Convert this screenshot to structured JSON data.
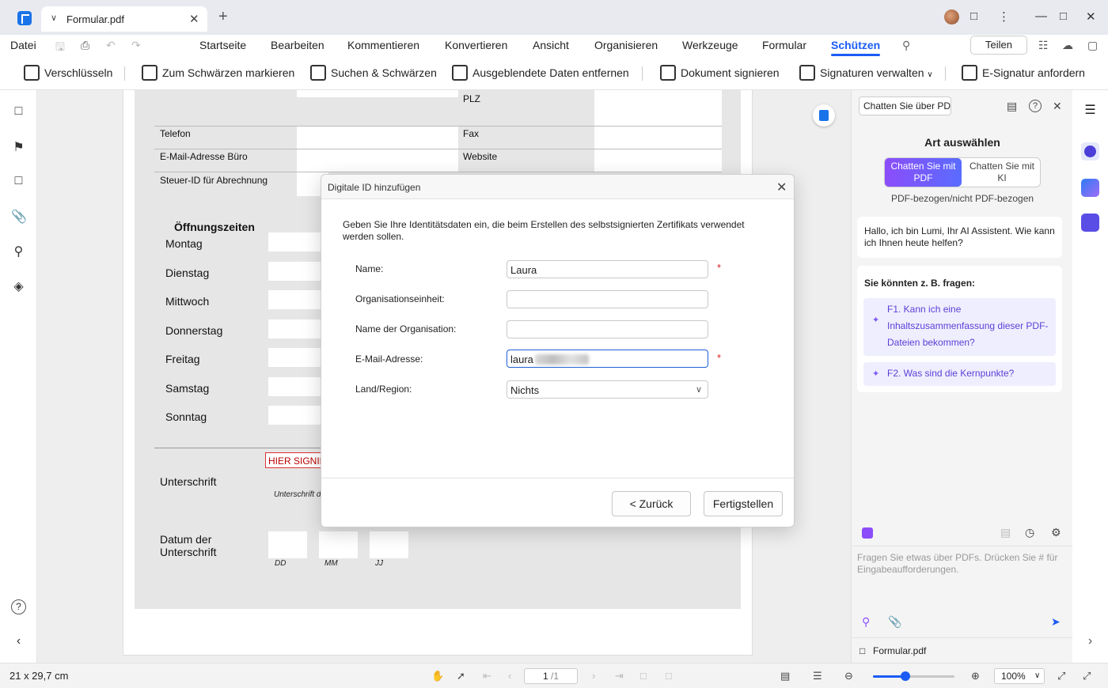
{
  "tab": {
    "title": "Formular.pdf"
  },
  "menu": {
    "file": "Datei",
    "items": [
      "Startseite",
      "Bearbeiten",
      "Kommentieren",
      "Konvertieren",
      "Ansicht",
      "Organisieren",
      "Werkzeuge",
      "Formular",
      "Schützen"
    ],
    "active": "Schützen",
    "share": "Teilen"
  },
  "toolbar": {
    "items": [
      "Verschlüsseln",
      "Zum Schwärzen markieren",
      "Suchen & Schwärzen",
      "Ausgeblendete Daten entfernen",
      "Dokument signieren",
      "Signaturen verwalten",
      "E-Signatur anfordern"
    ]
  },
  "form": {
    "plz": "PLZ",
    "telefon": "Telefon",
    "fax": "Fax",
    "email_buero": "E-Mail-Adresse Büro",
    "website": "Website",
    "steuer": "Steuer-ID für Abrechnung",
    "oeffnungszeiten": "Öffnungszeiten",
    "days": [
      "Montag",
      "Dienstag",
      "Mittwoch",
      "Donnerstag",
      "Freitag",
      "Samstag",
      "Sonntag"
    ],
    "sig_tag": "HIER SIGNIEREN",
    "unterschrift": "Unterschrift",
    "unterschrift_hint": "Unterschrift d",
    "datum_1": "Datum der",
    "datum_2": "Unterschrift",
    "dd": "DD",
    "mm": "MM",
    "jj": "JJ"
  },
  "dialog": {
    "title": "Digitale ID hinzufügen",
    "description": "Geben Sie Ihre Identitätsdaten ein, die beim Erstellen des selbstsignierten Zertifikats verwendet werden sollen.",
    "name_label": "Name:",
    "name_value": "Laura",
    "org_unit_label": "Organisationseinheit:",
    "org_unit_value": "",
    "org_name_label": "Name der Organisation:",
    "org_name_value": "",
    "email_label": "E-Mail-Adresse:",
    "email_value": "laura",
    "country_label": "Land/Region:",
    "country_value": "Nichts",
    "required_mark": "*",
    "back_button": "< Zurück",
    "finish_button": "Fertigstellen"
  },
  "ai_panel": {
    "dropdown": "Chatten Sie über PDF",
    "heading": "Art auswählen",
    "mode_pdf": "Chatten Sie mit PDF",
    "mode_ki": "Chatten Sie mit KI",
    "subtitle": "PDF-bezogen/nicht PDF-bezogen",
    "greeting": "Hallo, ich bin Lumi, Ihr AI Assistent. Wie kann ich Ihnen heute helfen?",
    "suggest_title": "Sie könnten z. B. fragen:",
    "suggestions": [
      "F1. Kann ich eine Inhaltszusammenfassung dieser PDF-Dateien bekommen?",
      "F2. Was sind die Kernpunkte?"
    ],
    "input_placeholder": "Fragen Sie etwas über PDFs. Drücken Sie # für Eingabeaufforderungen.",
    "file_name": "Formular.pdf"
  },
  "status": {
    "page_size": "21 x 29,7 cm",
    "page_current": "1",
    "page_total": "/1",
    "zoom": "100%",
    "zoom_slider_fraction": 0.4
  },
  "colors": {
    "accent": "#1a5cf5",
    "ai_gradient_start": "#8b4dfa",
    "ai_gradient_end": "#5a6cff",
    "required": "#dd2222"
  }
}
